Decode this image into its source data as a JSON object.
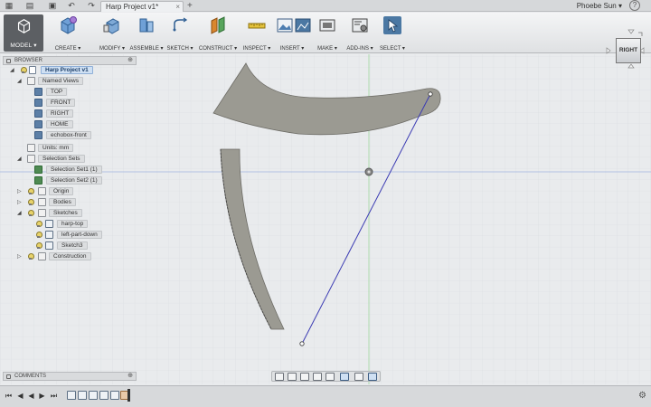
{
  "titlebar": {
    "tab_title": "Harp Project v1*",
    "close_symbol": "×",
    "new_tab_symbol": "+",
    "user_name": "Phoebe Sun ▾",
    "help_symbol": "?"
  },
  "ribbon": {
    "workspace_label": "MODEL ▾",
    "groups": [
      {
        "label": "CREATE ▾",
        "icon": "cube-icon"
      },
      {
        "label": "MODIFY ▾",
        "icon": "modify-icon"
      },
      {
        "label": "ASSEMBLE ▾",
        "icon": "assemble-icon"
      },
      {
        "label": "SKETCH ▾",
        "icon": "sketch-icon"
      },
      {
        "label": "CONSTRUCT ▾",
        "icon": "construct-icon"
      },
      {
        "label": "INSPECT ▾",
        "icon": "inspect-icon"
      },
      {
        "label": "INSERT ▾",
        "icon": "insert-icon"
      },
      {
        "label": "MAKE ▾",
        "icon": "make-icon"
      },
      {
        "label": "ADD-INS ▾",
        "icon": "addins-icon"
      },
      {
        "label": "SELECT ▾",
        "icon": "select-icon"
      }
    ]
  },
  "viewcube": {
    "face": "RIGHT"
  },
  "browser": {
    "title": "BROWSER",
    "root": "Harp Project v1",
    "named_views_label": "Named Views",
    "named_views": [
      "TOP",
      "FRONT",
      "RIGHT",
      "HOME",
      "echobox-front"
    ],
    "units": "Units: mm",
    "selection_sets_label": "Selection Sets",
    "selection_sets": [
      "Selection Set1 (1)",
      "Selection Set2 (1)"
    ],
    "origin": "Origin",
    "bodies": "Bodies",
    "sketches_label": "Sketches",
    "sketches": [
      "harp-top",
      "left-part-down",
      "Sketch3"
    ],
    "construction": "Construction"
  },
  "comments": {
    "title": "COMMENTS"
  },
  "colors": {
    "canvas_bg": "#e9ebed",
    "grid_line": "#d4d7da",
    "axis_green": "#9fd79f",
    "axis_blue": "#9fb4e0",
    "body_fill": "#9b9a92",
    "sketch_line": "#3b3bb3"
  }
}
